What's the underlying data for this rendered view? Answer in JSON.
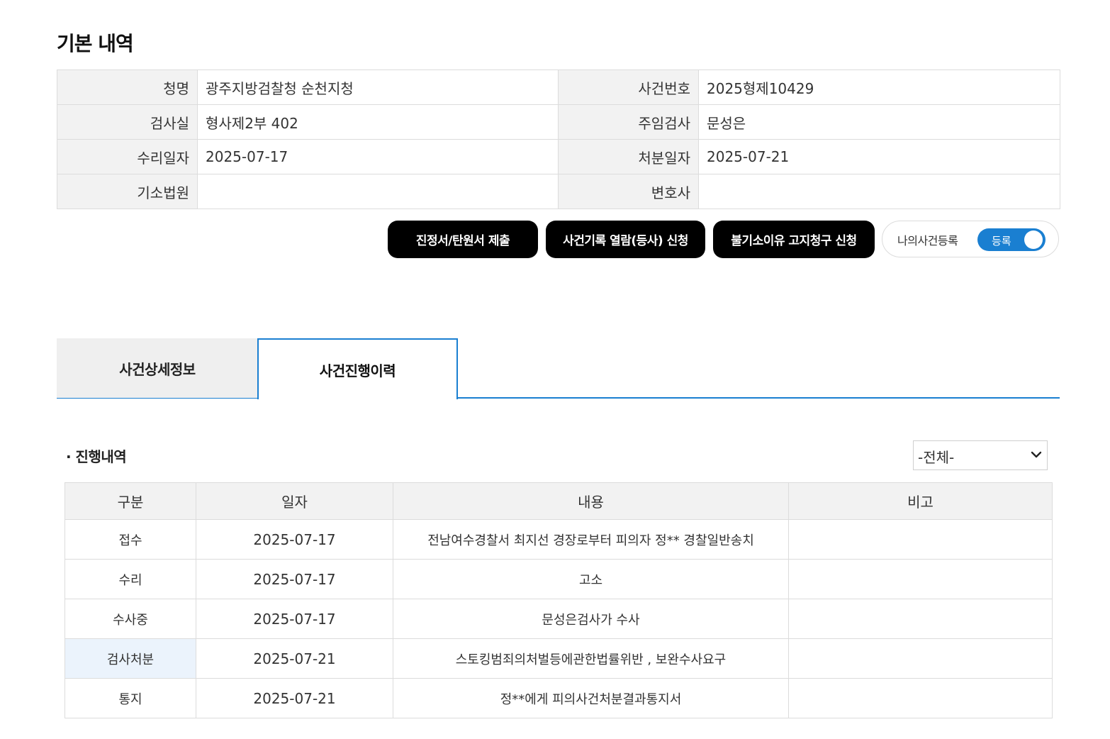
{
  "section_title": "기본 내역",
  "info": {
    "office_label": "청명",
    "office_value": "광주지방검찰청 순천지청",
    "case_no_label": "사건번호",
    "case_no_value": "2025형제10429",
    "room_label": "검사실",
    "room_value": "형사제2부 402",
    "prosecutor_label": "주임검사",
    "prosecutor_value": "문성은",
    "received_label": "수리일자",
    "received_value": "2025-07-17",
    "disposition_label": "처분일자",
    "disposition_value": "2025-07-21",
    "court_label": "기소법원",
    "court_value": "",
    "lawyer_label": "변호사",
    "lawyer_value": ""
  },
  "buttons": {
    "petition": "진정서/탄원서 제출",
    "record_view": "사건기록 열람(등사) 신청",
    "non_prosecution": "불기소이유 고지청구 신청"
  },
  "my_case": {
    "label": "나의사건등록",
    "toggle_text": "등록",
    "toggle_on": true
  },
  "tabs": [
    {
      "label": "사건상세정보",
      "active": false
    },
    {
      "label": "사건진행이력",
      "active": true
    }
  ],
  "progress": {
    "title": "· 진행내역",
    "filter_selected": "-전체-",
    "columns": [
      "구분",
      "일자",
      "내용",
      "비고"
    ],
    "rows": [
      {
        "type": "접수",
        "date": "2025-07-17",
        "content": "전남여수경찰서 최지선 경장로부터 피의자 정** 경찰일반송치",
        "note": ""
      },
      {
        "type": "수리",
        "date": "2025-07-17",
        "content": "고소",
        "note": ""
      },
      {
        "type": "수사중",
        "date": "2025-07-17",
        "content": "문성은검사가 수사",
        "note": ""
      },
      {
        "type": "검사처분",
        "date": "2025-07-21",
        "content": "스토킹범죄의처벌등에관한법률위반 , 보완수사요구",
        "note": ""
      },
      {
        "type": "통지",
        "date": "2025-07-21",
        "content": "정**에게 피의사건처분결과통지서",
        "note": ""
      }
    ]
  },
  "colors": {
    "accent": "#1a7fd1",
    "header_bg": "#f2f2f2",
    "button_bg": "#000000",
    "highlight_cell": "#ebf3fc"
  }
}
